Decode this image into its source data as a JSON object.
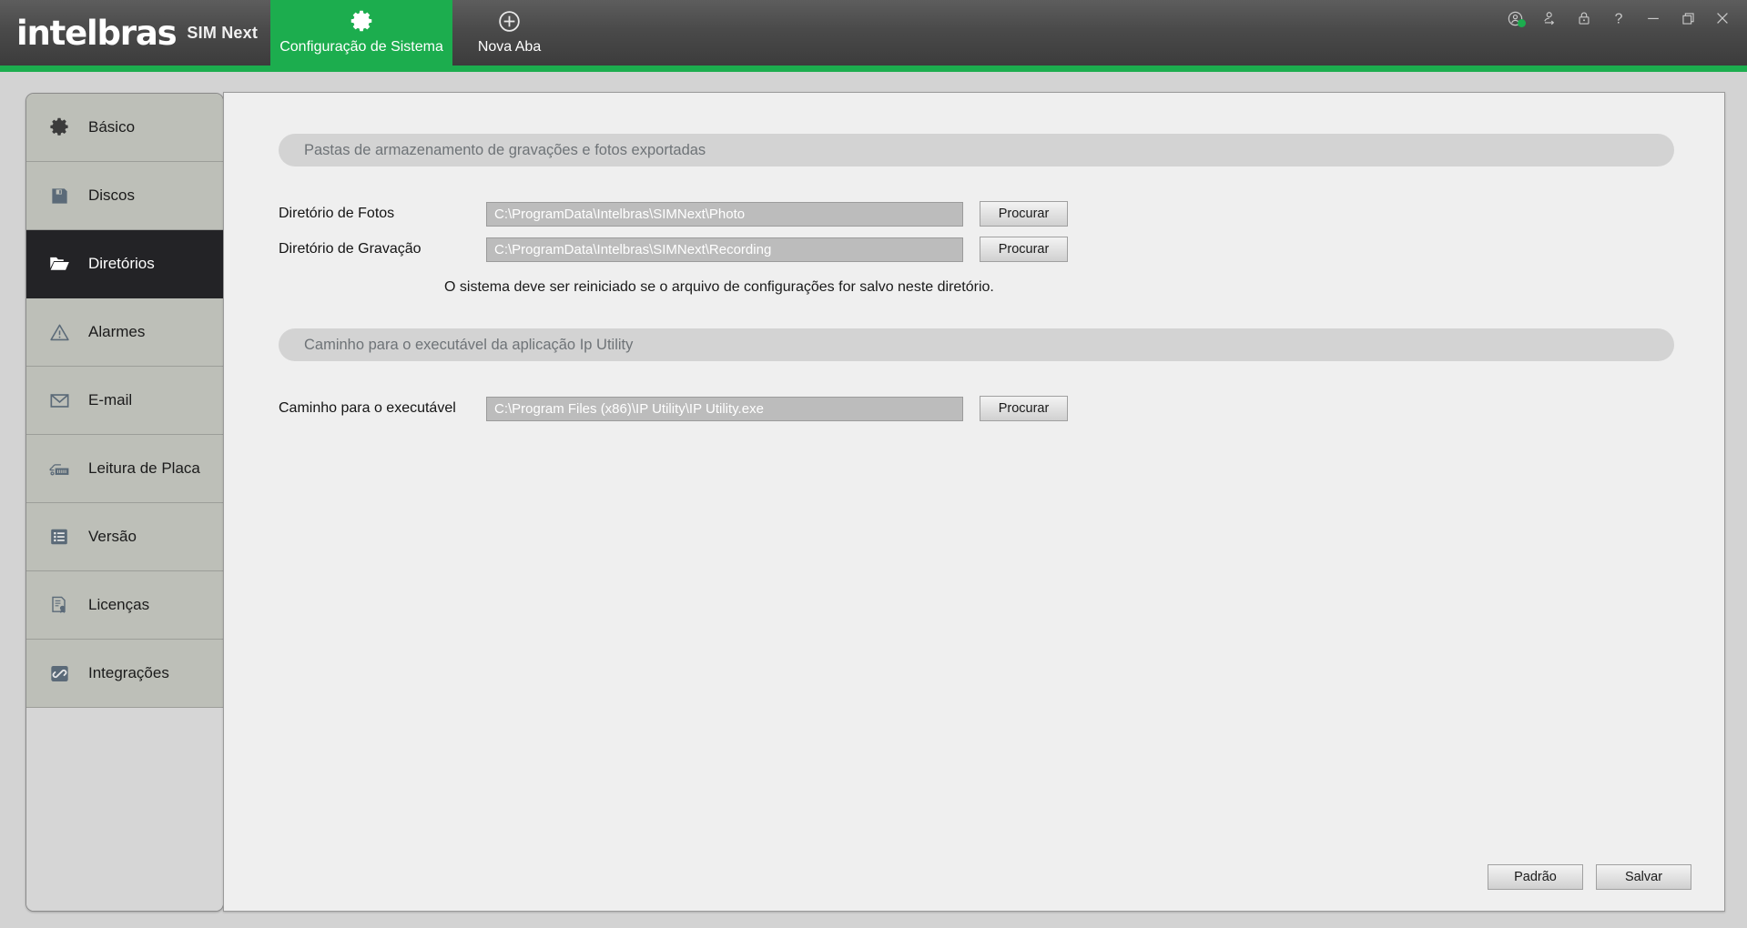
{
  "titlebar": {
    "brand": "intelbras",
    "product": "SIM Next",
    "tabs": [
      {
        "label": "Configuração de Sistema",
        "icon": "gear-icon",
        "active": true
      },
      {
        "label": "Nova Aba",
        "icon": "plus-circle-icon",
        "active": false
      }
    ],
    "window_controls": [
      {
        "name": "user-status-icon",
        "title": "Usuário"
      },
      {
        "name": "switch-user-icon",
        "title": "Trocar usuário"
      },
      {
        "name": "lock-icon",
        "title": "Bloquear"
      },
      {
        "name": "help-icon",
        "title": "Ajuda"
      },
      {
        "name": "minimize-icon",
        "title": "Minimizar"
      },
      {
        "name": "restore-icon",
        "title": "Restaurar"
      },
      {
        "name": "close-icon",
        "title": "Fechar"
      }
    ]
  },
  "colors": {
    "brand_green": "#1cad4e",
    "titlebar_dark": "#4a4a4a",
    "nav_active_bg": "#232326",
    "nav_bg": "#bdbfb8",
    "status_dot": "#1cad4e"
  },
  "sidebar": {
    "items": [
      {
        "label": "Básico",
        "icon": "gear-icon",
        "active": false
      },
      {
        "label": "Discos",
        "icon": "floppy-icon",
        "active": false
      },
      {
        "label": "Diretórios",
        "icon": "folder-icon",
        "active": true
      },
      {
        "label": "Alarmes",
        "icon": "warning-icon",
        "active": false
      },
      {
        "label": "E-mail",
        "icon": "envelope-icon",
        "active": false
      },
      {
        "label": "Leitura de Placa",
        "icon": "car-plate-icon",
        "active": false
      },
      {
        "label": "Versão",
        "icon": "list-icon",
        "active": false
      },
      {
        "label": "Licenças",
        "icon": "certificate-icon",
        "active": false
      },
      {
        "label": "Integrações",
        "icon": "link-icon",
        "active": false
      }
    ]
  },
  "main": {
    "section_storage": {
      "title": "Pastas de armazenamento de gravações e fotos exportadas",
      "fields": [
        {
          "label": "Diretório de Fotos",
          "value": "C:\\ProgramData\\Intelbras\\SIMNext\\Photo",
          "placeholder": "C:\\ProgramData\\Intelbras\\SIMNext\\Photo",
          "button": "Procurar"
        },
        {
          "label": "Diretório de Gravação",
          "value": "C:\\ProgramData\\Intelbras\\SIMNext\\Recording",
          "placeholder": "C:\\ProgramData\\Intelbras\\SIMNext\\Recording",
          "button": "Procurar"
        }
      ],
      "note": "O sistema deve ser reiniciado se o arquivo de configurações for salvo neste diretório."
    },
    "section_executable": {
      "title": "Caminho para o executável da aplicação Ip Utility",
      "field": {
        "label": "Caminho para o executável",
        "value": "C:\\Program Files (x86)\\IP Utility\\IP Utility.exe",
        "placeholder": "C:\\Program Files (x86)\\IP Utility\\IP Utility.exe",
        "button": "Procurar"
      }
    },
    "actions": {
      "default_label": "Padrão",
      "save_label": "Salvar"
    }
  }
}
